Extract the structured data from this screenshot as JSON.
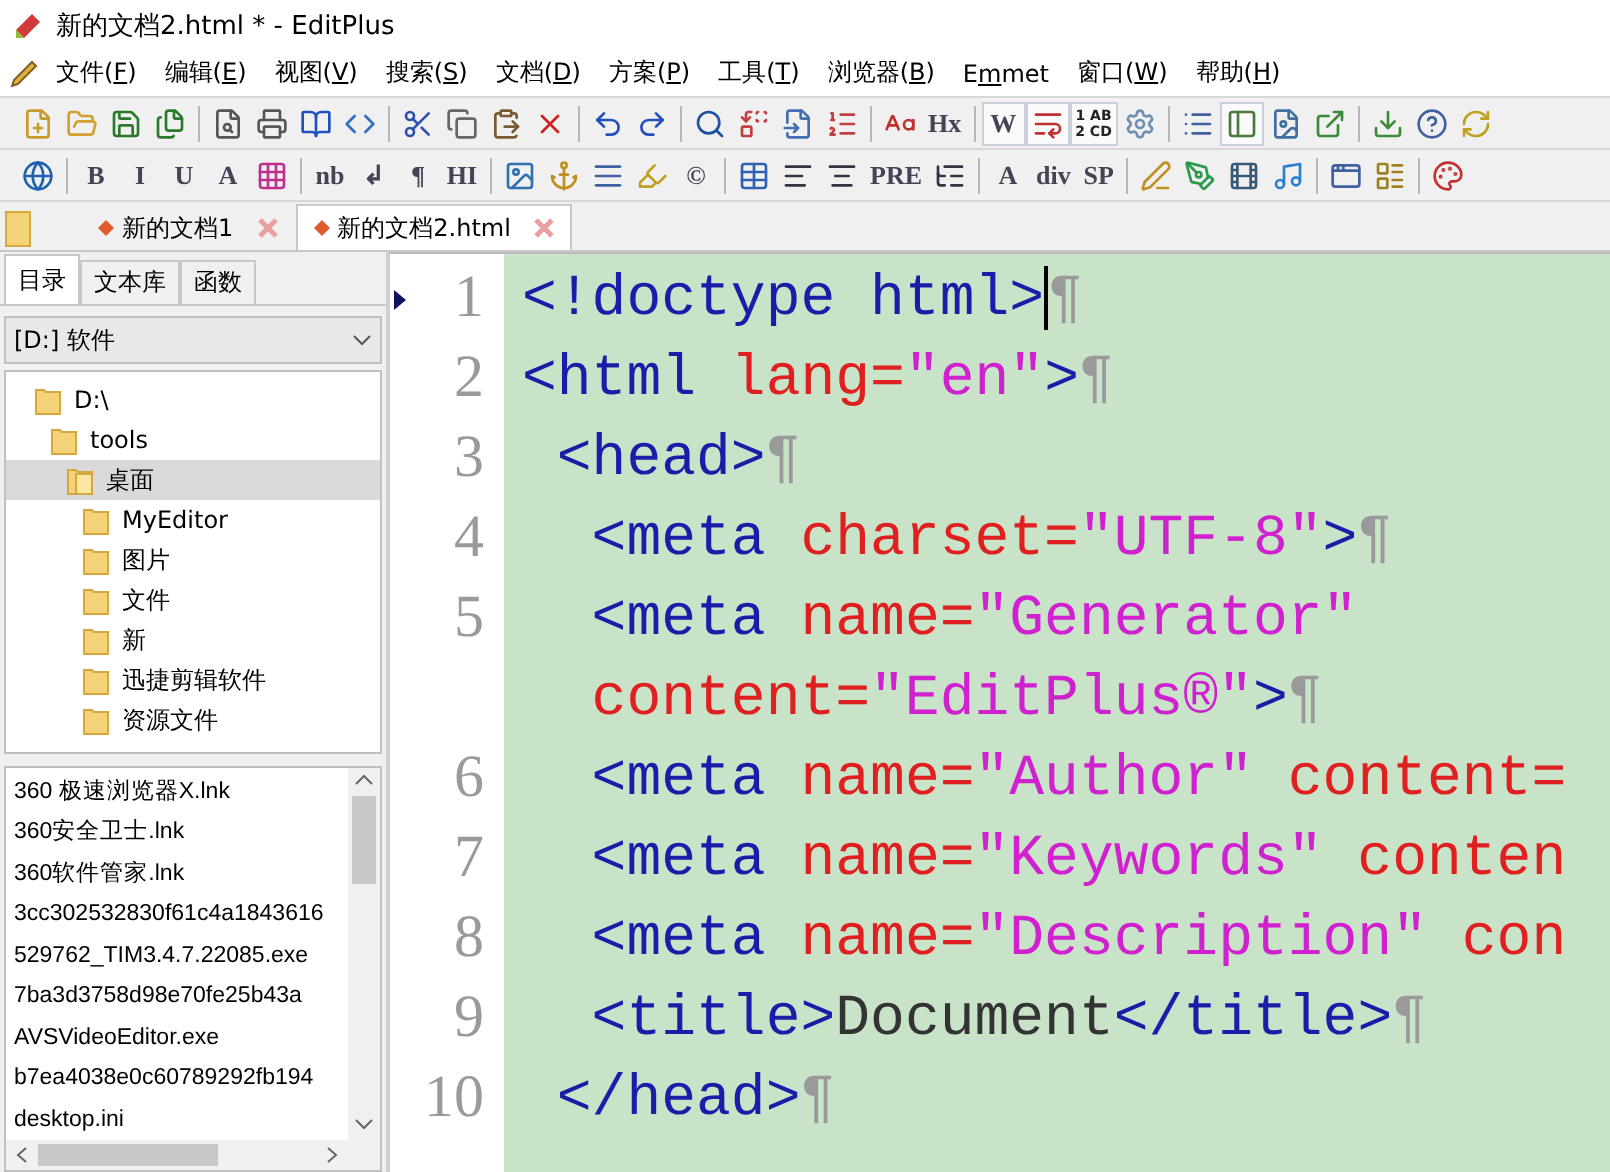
{
  "window": {
    "title": "新的文档2.html * - EditPlus"
  },
  "menu": [
    {
      "head": "文件(",
      "key": "F",
      "tail": ")"
    },
    {
      "head": "编辑(",
      "key": "E",
      "tail": ")"
    },
    {
      "head": "视图(",
      "key": "V",
      "tail": ")"
    },
    {
      "head": "搜索(",
      "key": "S",
      "tail": ")"
    },
    {
      "head": "文档(",
      "key": "D",
      "tail": ")"
    },
    {
      "head": "方案(",
      "key": "P",
      "tail": ")"
    },
    {
      "head": "工具(",
      "key": "T",
      "tail": ")"
    },
    {
      "head": "浏览器(",
      "key": "B",
      "tail": ")"
    },
    {
      "head": "E",
      "key": "m",
      "tail": "met"
    },
    {
      "head": "窗口(",
      "key": "W",
      "tail": ")"
    },
    {
      "head": "帮助(",
      "key": "H",
      "tail": ")"
    }
  ],
  "toolbar_1": [
    {
      "kind": "icon",
      "on": false
    },
    {
      "kind": "icon",
      "on": false
    },
    {
      "kind": "icon",
      "on": false
    },
    {
      "kind": "icon",
      "on": false
    },
    {
      "kind": "sep"
    },
    {
      "kind": "icon",
      "on": false
    },
    {
      "kind": "icon",
      "on": false
    },
    {
      "kind": "icon",
      "on": false
    },
    {
      "kind": "icon",
      "on": false
    },
    {
      "kind": "sep"
    },
    {
      "kind": "icon",
      "on": false
    },
    {
      "kind": "icon",
      "on": false
    },
    {
      "kind": "icon",
      "on": false
    },
    {
      "kind": "icon",
      "on": false
    },
    {
      "kind": "sep"
    },
    {
      "kind": "icon",
      "on": false
    },
    {
      "kind": "icon",
      "on": false
    },
    {
      "kind": "sep"
    },
    {
      "kind": "icon",
      "on": false
    },
    {
      "kind": "icon",
      "on": false
    },
    {
      "kind": "icon",
      "on": false
    },
    {
      "kind": "icon",
      "on": false
    },
    {
      "kind": "sep"
    },
    {
      "kind": "icon",
      "on": false
    },
    {
      "kind": "text",
      "label": "Hx",
      "on": false
    },
    {
      "kind": "sep"
    },
    {
      "kind": "text",
      "label": "W",
      "on": true
    },
    {
      "kind": "icon",
      "on": true
    },
    {
      "kind": "stack",
      "lines": [
        "1 AB",
        "2 CD"
      ],
      "on": true
    },
    {
      "kind": "icon",
      "on": false
    },
    {
      "kind": "sep"
    },
    {
      "kind": "icon",
      "on": false
    },
    {
      "kind": "icon",
      "on": true
    },
    {
      "kind": "icon",
      "on": false
    },
    {
      "kind": "icon",
      "on": false
    },
    {
      "kind": "sep"
    },
    {
      "kind": "icon",
      "on": false
    },
    {
      "kind": "icon",
      "on": false
    },
    {
      "kind": "icon",
      "on": false
    }
  ],
  "toolbar_2": [
    {
      "kind": "icon",
      "on": false
    },
    {
      "kind": "sep"
    },
    {
      "kind": "text",
      "label": "B",
      "on": false
    },
    {
      "kind": "text",
      "label": "I",
      "on": false
    },
    {
      "kind": "text",
      "label": "U",
      "on": false
    },
    {
      "kind": "text",
      "label": "A",
      "on": false
    },
    {
      "kind": "icon",
      "on": false
    },
    {
      "kind": "sep"
    },
    {
      "kind": "text",
      "label": "nb",
      "on": false
    },
    {
      "kind": "text",
      "label": "↲",
      "on": false
    },
    {
      "kind": "text",
      "label": "¶",
      "on": false
    },
    {
      "kind": "text",
      "label": "HI",
      "on": false
    },
    {
      "kind": "sep"
    },
    {
      "kind": "icon",
      "on": false
    },
    {
      "kind": "icon",
      "on": false
    },
    {
      "kind": "icon",
      "on": false
    },
    {
      "kind": "icon",
      "on": false
    },
    {
      "kind": "text",
      "label": "©",
      "on": false
    },
    {
      "kind": "sep"
    },
    {
      "kind": "icon",
      "on": false
    },
    {
      "kind": "icon",
      "on": false
    },
    {
      "kind": "icon",
      "on": false
    },
    {
      "kind": "text",
      "label": "PRE",
      "on": false
    },
    {
      "kind": "icon",
      "on": false
    },
    {
      "kind": "sep"
    },
    {
      "kind": "text",
      "label": "A",
      "on": false
    },
    {
      "kind": "text",
      "label": "div",
      "on": false
    },
    {
      "kind": "text",
      "label": "SP",
      "on": false
    },
    {
      "kind": "sep"
    },
    {
      "kind": "icon",
      "on": false
    },
    {
      "kind": "icon",
      "on": false
    },
    {
      "kind": "icon",
      "on": false
    },
    {
      "kind": "icon",
      "on": false
    },
    {
      "kind": "sep"
    },
    {
      "kind": "icon",
      "on": false
    },
    {
      "kind": "icon",
      "on": false
    },
    {
      "kind": "sep"
    },
    {
      "kind": "icon",
      "on": false
    }
  ],
  "doc_tabs": [
    {
      "label": "新的文档1",
      "selected": false
    },
    {
      "label": "新的文档2.html",
      "selected": true
    }
  ],
  "sidebar": {
    "tabs": [
      {
        "label": "目录",
        "selected": true
      },
      {
        "label": "文本库",
        "selected": false
      },
      {
        "label": "函数",
        "selected": false
      }
    ],
    "drive": "[D:] 软件",
    "tree": [
      {
        "label": "D:\\",
        "selected": false,
        "children": [
          {
            "label": "tools",
            "selected": false,
            "children": [
              {
                "label": "桌面",
                "selected": true,
                "children": [
                  {
                    "label": "MyEditor",
                    "selected": false
                  },
                  {
                    "label": "图片",
                    "selected": false
                  },
                  {
                    "label": "文件",
                    "selected": false
                  },
                  {
                    "label": "新",
                    "selected": false
                  },
                  {
                    "label": "迅捷剪辑软件",
                    "selected": false
                  },
                  {
                    "label": "资源文件",
                    "selected": false
                  }
                ]
              }
            ]
          }
        ]
      }
    ],
    "files": [
      "360 极速浏览器X.lnk",
      "360安全卫士.lnk",
      "360软件管家.lnk",
      "3cc302532830f61c4a1843616",
      "529762_TIM3.4.7.22085.exe",
      "7ba3d3758d98e70fe25b43a",
      "AVSVideoEditor.exe",
      "b7ea4038e0c60789292fb194",
      "desktop.ini"
    ]
  },
  "editor": {
    "lines": [
      {
        "number": "1",
        "rows": [
          [
            {
              "kind": "tag",
              "text": "<!doctype html>"
            },
            {
              "kind": "caret"
            },
            {
              "kind": "mark",
              "text": "¶"
            }
          ]
        ]
      },
      {
        "number": "2",
        "rows": [
          [
            {
              "kind": "tag",
              "text": "<html"
            },
            {
              "kind": "attr",
              "text": " lang="
            },
            {
              "kind": "value",
              "text": "\"en\""
            },
            {
              "kind": "tag",
              "text": ">"
            },
            {
              "kind": "mark",
              "text": "¶"
            }
          ]
        ]
      },
      {
        "number": "3",
        "rows": [
          [
            {
              "kind": "tag",
              "text": " <head>"
            },
            {
              "kind": "mark",
              "text": "¶"
            }
          ]
        ]
      },
      {
        "number": "4",
        "rows": [
          [
            {
              "kind": "tag",
              "text": "  <meta"
            },
            {
              "kind": "attr",
              "text": " charset="
            },
            {
              "kind": "value",
              "text": "\"UTF-8\""
            },
            {
              "kind": "tag",
              "text": ">"
            },
            {
              "kind": "mark",
              "text": "¶"
            }
          ]
        ]
      },
      {
        "number": "5",
        "rows": [
          [
            {
              "kind": "tag",
              "text": "  <meta"
            },
            {
              "kind": "attr",
              "text": " name="
            },
            {
              "kind": "value",
              "text": "\"Generator\""
            }
          ],
          [
            {
              "kind": "attr",
              "text": "  content="
            },
            {
              "kind": "value",
              "text": "\"EditPlus®\""
            },
            {
              "kind": "tag",
              "text": ">"
            },
            {
              "kind": "mark",
              "text": "¶"
            }
          ]
        ]
      },
      {
        "number": "6",
        "rows": [
          [
            {
              "kind": "tag",
              "text": "  <meta"
            },
            {
              "kind": "attr",
              "text": " name="
            },
            {
              "kind": "value",
              "text": "\"Author\""
            },
            {
              "kind": "attr",
              "text": " content="
            }
          ]
        ]
      },
      {
        "number": "7",
        "rows": [
          [
            {
              "kind": "tag",
              "text": "  <meta"
            },
            {
              "kind": "attr",
              "text": " name="
            },
            {
              "kind": "value",
              "text": "\"Keywords\""
            },
            {
              "kind": "attr",
              "text": " conten"
            }
          ]
        ]
      },
      {
        "number": "8",
        "rows": [
          [
            {
              "kind": "tag",
              "text": "  <meta"
            },
            {
              "kind": "attr",
              "text": " name="
            },
            {
              "kind": "value",
              "text": "\"Description\""
            },
            {
              "kind": "attr",
              "text": " con"
            }
          ]
        ]
      },
      {
        "number": "9",
        "rows": [
          [
            {
              "kind": "tag",
              "text": "  <title>"
            },
            {
              "kind": "plain",
              "text": "Document"
            },
            {
              "kind": "tag",
              "text": "</title>"
            },
            {
              "kind": "mark",
              "text": "¶"
            }
          ]
        ]
      },
      {
        "number": "10",
        "rows": [
          [
            {
              "kind": "tag",
              "text": " </head>"
            },
            {
              "kind": "mark",
              "text": "¶"
            }
          ]
        ]
      }
    ]
  }
}
